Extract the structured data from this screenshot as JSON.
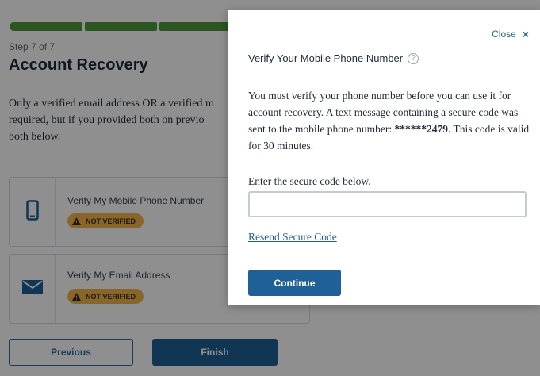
{
  "background": {
    "step": "Step 7 of 7",
    "title": "Account Recovery",
    "intro": [
      "Only a verified email address OR a verified m",
      "required, but if you provided both on previo",
      "both below."
    ],
    "cards": [
      {
        "label": "Verify My Mobile Phone Number",
        "badge": "NOT VERIFIED",
        "icon": "mobile-phone-icon"
      },
      {
        "label": "Verify My Email Address",
        "badge": "NOT VERIFIED",
        "icon": "envelope-icon"
      }
    ],
    "buttons": {
      "previous": "Previous",
      "finish": "Finish"
    }
  },
  "modal": {
    "close_label": "Close",
    "close_icon": "×",
    "title": "Verify Your Mobile Phone Number",
    "help_icon": "?",
    "body_prefix": "You must verify your phone number before you can use it for account recovery. A text message containing a secure code was sent to the mobile phone number: ",
    "masked_number": "******2479",
    "body_suffix": ". This code is valid for 30 minutes.",
    "code_label": "Enter the secure code below.",
    "code_value": "",
    "resend_label": "Resend Secure Code",
    "continue_label": "Continue"
  },
  "colors": {
    "progress": "#4f9a3c",
    "primary": "#1f6196",
    "badge": "#f2b64a",
    "overlay": "rgba(0,0,0,0.44)"
  }
}
